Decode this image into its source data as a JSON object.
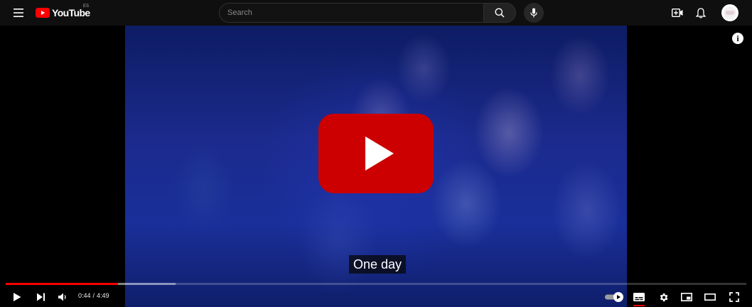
{
  "masthead": {
    "logo_text": "YouTube",
    "country_code": "ES",
    "search_placeholder": "Search",
    "icons": [
      "menu-icon",
      "search-icon",
      "mic-icon",
      "create-icon",
      "bell-icon",
      "avatar"
    ]
  },
  "player": {
    "caption": "One day",
    "time_current": "0:44",
    "time_separator": "/",
    "time_total": "4:49",
    "progress_played_fraction": 0.152,
    "progress_buffered_fraction": 0.229,
    "autoplay_on": true,
    "captions_on": true,
    "colors": {
      "played": "#ff0000",
      "brand": "#ff0000",
      "big_play": "#cc0000"
    }
  }
}
